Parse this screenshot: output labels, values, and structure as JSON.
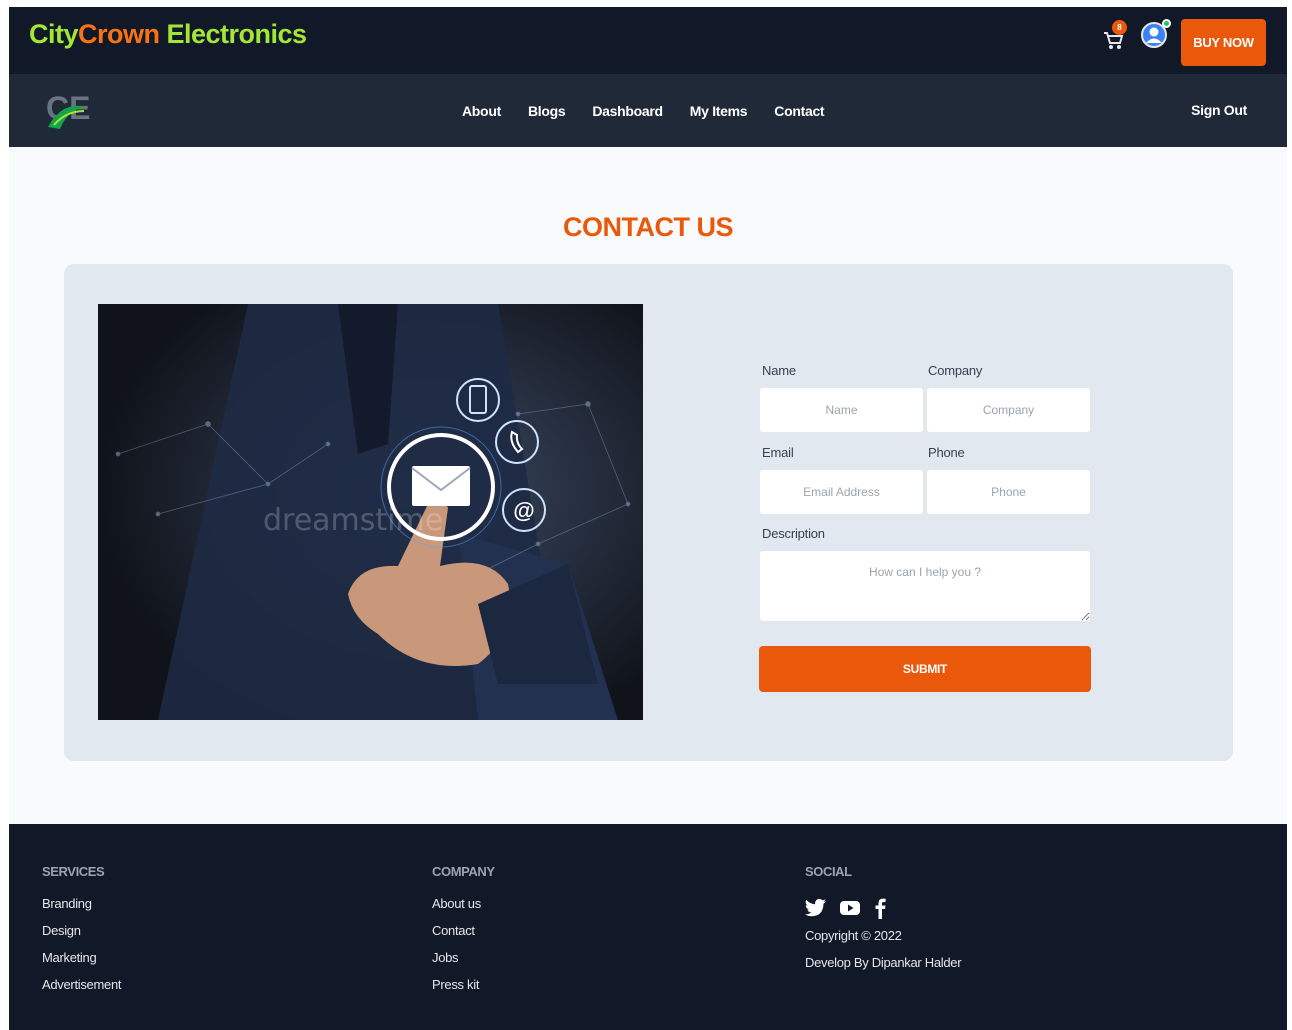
{
  "brand": {
    "part1": "City",
    "part2": "Crown",
    "part3": " Electronics"
  },
  "header": {
    "cart_count": "8",
    "buy_now": "BUY NOW"
  },
  "nav": {
    "links": [
      "About",
      "Blogs",
      "Dashboard",
      "My Items",
      "Contact"
    ],
    "sign_out": "Sign Out"
  },
  "contact": {
    "title": "CONTACT US",
    "image_watermark": "dreamstime",
    "form": {
      "name_label": "Name",
      "name_placeholder": "Name",
      "company_label": "Company",
      "company_placeholder": "Company",
      "email_label": "Email",
      "email_placeholder": "Email Address",
      "phone_label": "Phone",
      "phone_placeholder": "Phone",
      "description_label": "Description",
      "description_placeholder": "How can I help you ?",
      "submit": "SUBMIT"
    }
  },
  "footer": {
    "services": {
      "heading": "SERVICES",
      "items": [
        "Branding",
        "Design",
        "Marketing",
        "Advertisement"
      ]
    },
    "company": {
      "heading": "COMPANY",
      "items": [
        "About us",
        "Contact",
        "Jobs",
        "Press kit"
      ]
    },
    "social": {
      "heading": "SOCIAL",
      "icons": [
        "twitter-icon",
        "youtube-icon",
        "facebook-icon"
      ],
      "copyright": "Copyright © 2022",
      "developer": "Develop By Dipankar Halder"
    }
  },
  "colors": {
    "accent": "#ea580c",
    "brand_green": "#a3e635",
    "dark": "#111827",
    "nav": "#1f2937"
  }
}
